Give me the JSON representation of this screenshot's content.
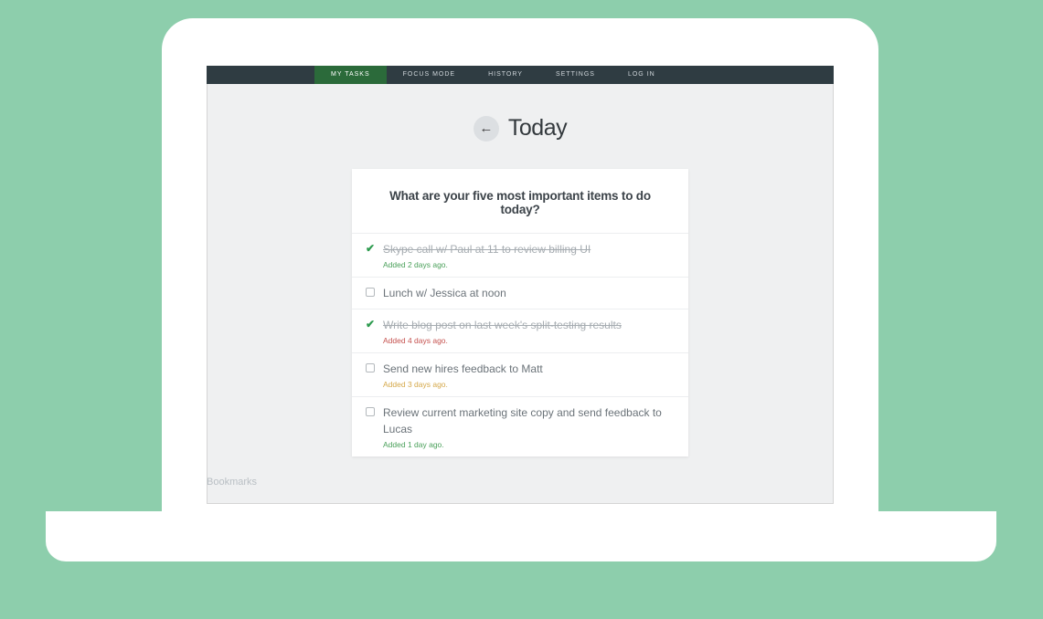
{
  "nav": {
    "items": [
      {
        "label": "MY TASKS",
        "active": true
      },
      {
        "label": "FOCUS MODE",
        "active": false
      },
      {
        "label": "HISTORY",
        "active": false
      },
      {
        "label": "SETTINGS",
        "active": false
      },
      {
        "label": "LOG IN",
        "active": false
      }
    ]
  },
  "header": {
    "title": "Today"
  },
  "card": {
    "prompt": "What are your five most important items to do today?"
  },
  "tasks": [
    {
      "text": "Skype call w/ Paul at 11 to review billing UI",
      "done": true,
      "meta": "Added 2 days ago.",
      "meta_color": "green"
    },
    {
      "text": "Lunch w/ Jessica at noon",
      "done": false,
      "meta": "",
      "meta_color": ""
    },
    {
      "text": "Write blog post on last week's split-testing results",
      "done": true,
      "meta": "Added 4 days ago.",
      "meta_color": "red"
    },
    {
      "text": "Send new hires feedback to Matt",
      "done": false,
      "meta": "Added 3 days ago.",
      "meta_color": "amber"
    },
    {
      "text": "Review current marketing site copy and send feedback to Lucas",
      "done": false,
      "meta": "Added 1 day ago.",
      "meta_color": "green"
    }
  ],
  "footer": {
    "bookmarks": "Bookmarks"
  }
}
